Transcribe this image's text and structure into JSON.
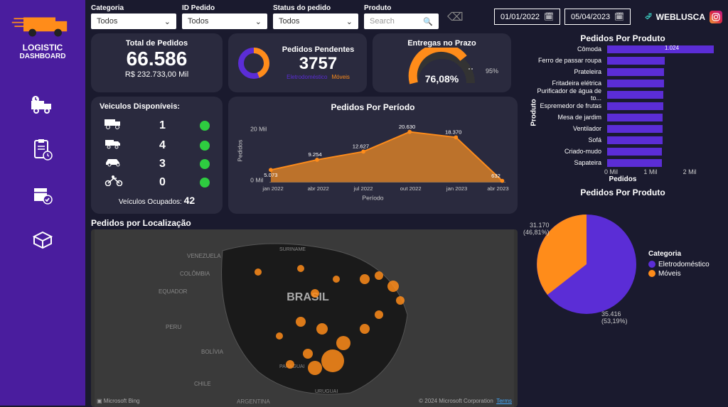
{
  "brand": {
    "name": "WEBLUSCA",
    "logo_line1": "LOGISTIC",
    "logo_line2": "DASHBOARD"
  },
  "filters": {
    "categoria": {
      "label": "Categoria",
      "value": "Todos"
    },
    "id_pedido": {
      "label": "ID Pedido",
      "value": "Todos"
    },
    "status": {
      "label": "Status do pedido",
      "value": "Todos"
    },
    "produto": {
      "label": "Produto",
      "placeholder": "Search"
    }
  },
  "dates": {
    "start": "01/01/2022",
    "end": "05/04/2023"
  },
  "kpi": {
    "total": {
      "title": "Total de Pedidos",
      "value": "66.586",
      "sub": "R$ 232.733,00 Mil"
    },
    "pendentes": {
      "title": "Pedidos Pendentes",
      "value": "3757",
      "cat1": "Eletrodoméstico",
      "cat2": "Móveis"
    },
    "prazo": {
      "title": "Entregas no Prazo",
      "pct": "76,08%",
      "target": "95%"
    }
  },
  "vehicles": {
    "title": "Veiculos Disponíveis:",
    "rows": [
      {
        "type": "truck-large",
        "count": "1"
      },
      {
        "type": "truck-small",
        "count": "4"
      },
      {
        "type": "car",
        "count": "3"
      },
      {
        "type": "motorcycle",
        "count": "0"
      }
    ],
    "footer_label": "Veículos Ocupados:",
    "footer_value": "42"
  },
  "period": {
    "title": "Pedidos Por Período",
    "xlabel": "Período",
    "ylabel": "Pedidos",
    "ytick": "20 Mil",
    "ytick0": "0 Mil"
  },
  "map": {
    "title": "Pedidos por Localização",
    "country": "BRASIL",
    "bing": "Microsoft Bing",
    "copyright": "© 2024 Microsoft Corporation",
    "terms": "Terms"
  },
  "bar": {
    "title": "Pedidos Por Produto",
    "highlight": "1.024",
    "ylabel": "Produto",
    "xlabel": "Pedidos",
    "ticks": [
      "0 Mil",
      "1 Mil",
      "2 Mil"
    ]
  },
  "pie": {
    "title": "Pedidos Por Produto",
    "legend_title": "Categoria",
    "legend1": "Eletrodoméstico",
    "legend2": "Móveis",
    "label1_val": "31.170",
    "label1_pct": "(46,81%)",
    "label2_val": "35.416",
    "label2_pct": "(53,19%)"
  },
  "chart_data": {
    "period_area": {
      "type": "area",
      "x": [
        "jan 2022",
        "abr 2022",
        "jul 2022",
        "out 2022",
        "jan 2023",
        "abr 2023"
      ],
      "values": [
        5073,
        9254,
        12627,
        20630,
        18370,
        632
      ],
      "title": "Pedidos Por Período",
      "xlabel": "Período",
      "ylabel": "Pedidos",
      "ylim": [
        0,
        22000
      ]
    },
    "product_bar": {
      "type": "bar",
      "categories": [
        "Cômoda",
        "Ferro de passar roupa",
        "Prateleira",
        "Fritadeira elétrica",
        "Purificador de água de to...",
        "Espremedor de frutas",
        "Mesa de jardim",
        "Ventilador",
        "Sofá",
        "Criado-mudo",
        "Sapateira"
      ],
      "values": [
        2041,
        1094,
        1093,
        1083,
        1079,
        1073,
        1062,
        1058,
        1053,
        1052,
        1052
      ],
      "title": "Pedidos Por Produto",
      "xlabel": "Pedidos",
      "ylabel": "Produto",
      "xlim": [
        0,
        2200
      ]
    },
    "category_pie": {
      "type": "pie",
      "series": [
        {
          "name": "Eletrodoméstico",
          "value": 35416,
          "pct": 53.19
        },
        {
          "name": "Móveis",
          "value": 31170,
          "pct": 46.81
        }
      ],
      "title": "Pedidos Por Produto"
    },
    "gauge": {
      "type": "gauge",
      "value": 76.08,
      "target": 95,
      "max": 100,
      "title": "Entregas no Prazo"
    }
  }
}
